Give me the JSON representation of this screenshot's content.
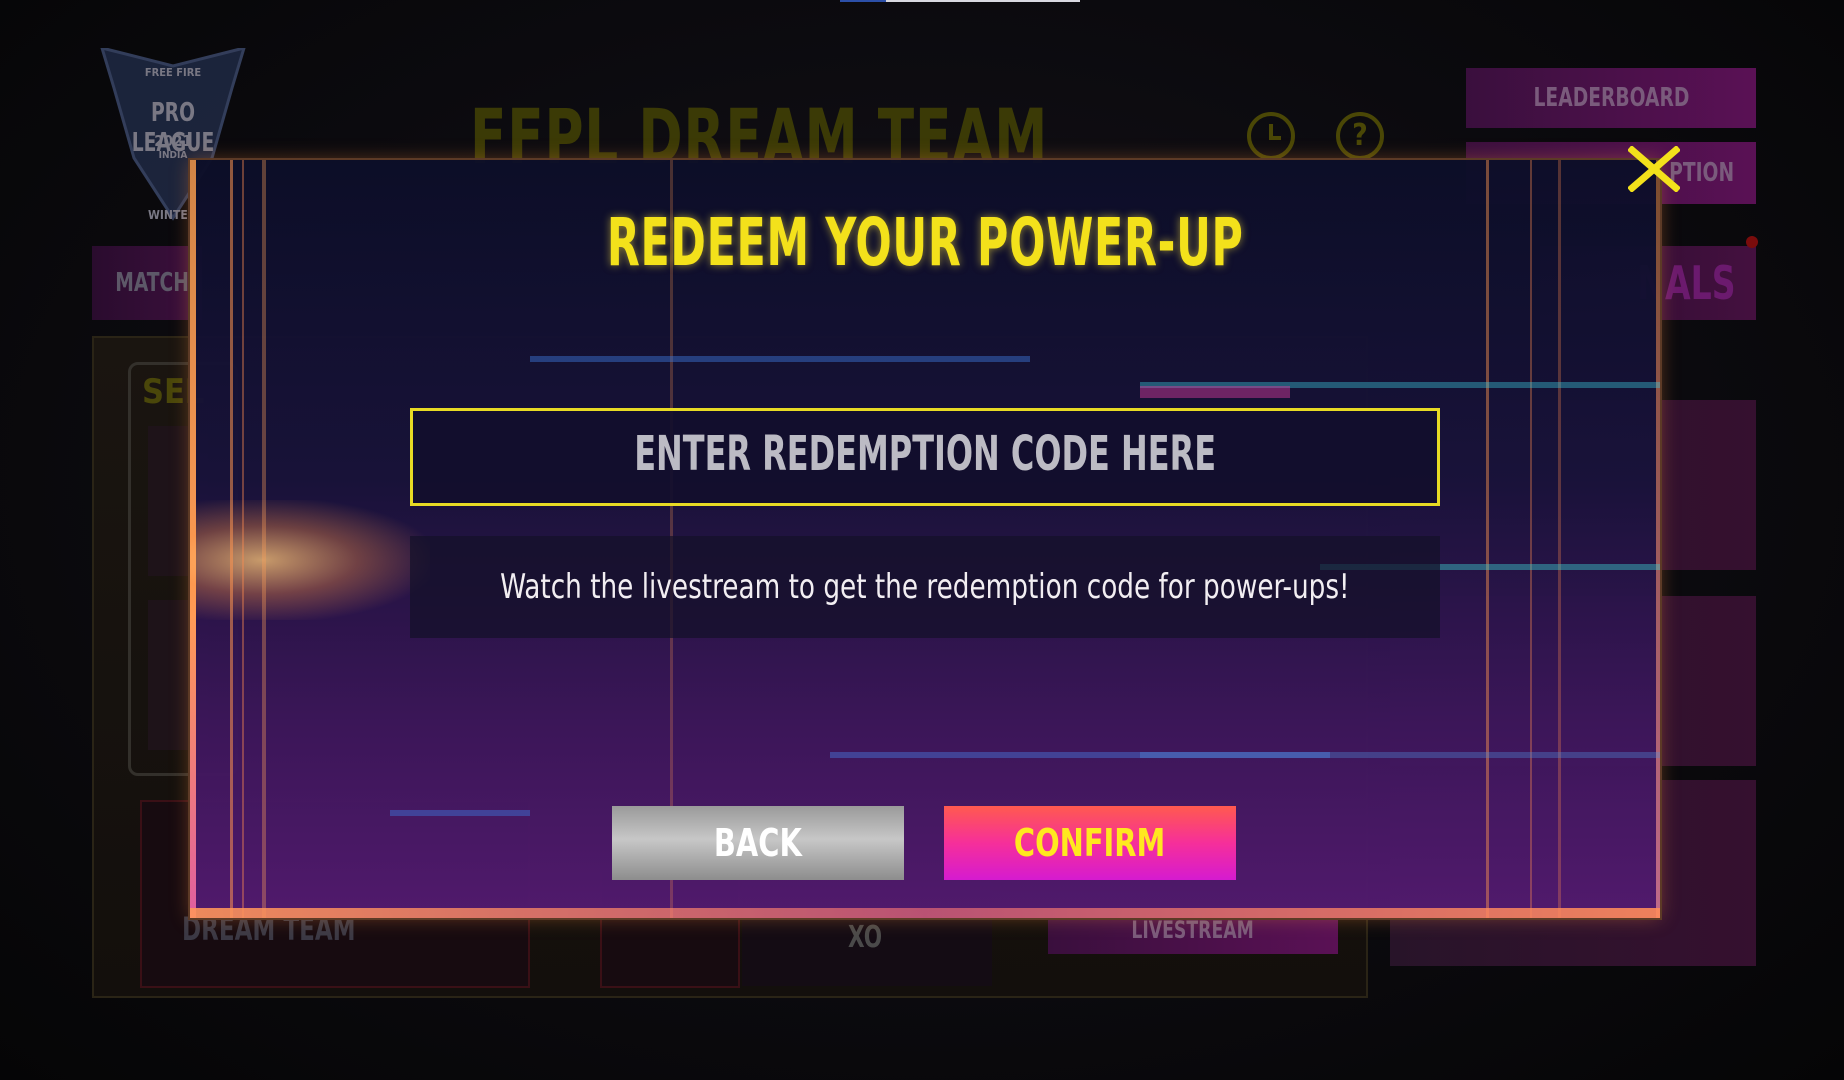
{
  "background": {
    "logo": {
      "line1": "FREE FIRE",
      "line2": "PRO LEAGUE",
      "line3": "2021",
      "line4": "INDIA",
      "line5": "WINTE"
    },
    "page_title": "FFPL DREAM TEAM",
    "clock_icon": "clock-icon",
    "help_icon": "help-icon",
    "help_glyph": "?",
    "buttons": {
      "leaderboard": "LEADERBOARD",
      "redemption": "PTION",
      "match": "MATCH",
      "finals": "NALS",
      "livestream": "LIVESTREAM"
    },
    "select_label": "SEL",
    "dream_team_label": "DREAM TEAM",
    "xo_label": "XO"
  },
  "modal": {
    "title": "REDEEM YOUR POWER-UP",
    "code_placeholder": "ENTER REDEMPTION CODE HERE",
    "code_value": "",
    "hint": "Watch the livestream to get the redemption code for power-ups!",
    "back_label": "BACK",
    "confirm_label": "CONFIRM",
    "close_icon": "close-icon"
  },
  "colors": {
    "title_yellow": "#f3e11b",
    "input_border": "#e7da24",
    "confirm_gradient_start": "#ff5a4f",
    "confirm_gradient_end": "#d51bd0",
    "back_gray": "#9a9a9a",
    "confirm_text": "#ffe81f"
  }
}
